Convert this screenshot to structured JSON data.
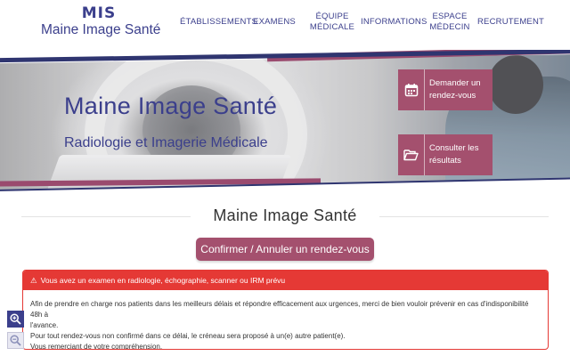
{
  "header": {
    "logo_mark": "MIS",
    "logo_text": "Maine Image Santé",
    "nav": [
      {
        "label_line1": "Établissements",
        "label_line2": ""
      },
      {
        "label_line1": "Examens",
        "label_line2": ""
      },
      {
        "label_line1": "Équipe",
        "label_line2": "médicale"
      },
      {
        "label_line1": "Informations",
        "label_line2": ""
      },
      {
        "label_line1": "Espace",
        "label_line2": "médecin"
      },
      {
        "label_line1": "Recrutement",
        "label_line2": ""
      }
    ]
  },
  "banner": {
    "title": "Maine Image Santé",
    "subtitle": "Radiologie et Imagerie Médicale",
    "cta_appointment": {
      "line1": "Demander un",
      "line2": "rendez-vous",
      "icon": "calendar-icon"
    },
    "cta_results": {
      "line1": "Consulter les",
      "line2": "résultats",
      "icon": "folder-open-icon"
    }
  },
  "main": {
    "section_title": "Maine Image Santé",
    "confirm_button": "Confirmer / Annuler un rendez-vous"
  },
  "alert": {
    "icon": "warning-icon",
    "title": "Vous avez un examen en radiologie, échographie, scanner ou IRM prévu",
    "line1": "Afin de prendre en charge nos patients dans les meilleurs délais et répondre efficacement aux urgences, merci de bien vouloir prévenir en cas d'indisponibilité 48h à",
    "line2": "l'avance.",
    "line3": "Pour tout rendez-vous non confirmé dans ce délai, le créneau sera proposé à un(e) autre patient(e).",
    "line4": "Vous remerciant de votre compréhension.",
    "accent_color": "#e53935"
  },
  "colors": {
    "brand_blue": "#3b3f8c",
    "brand_plum": "#a4506e"
  },
  "zoom": {
    "in_icon": "zoom-in-icon",
    "out_icon": "zoom-out-icon"
  }
}
